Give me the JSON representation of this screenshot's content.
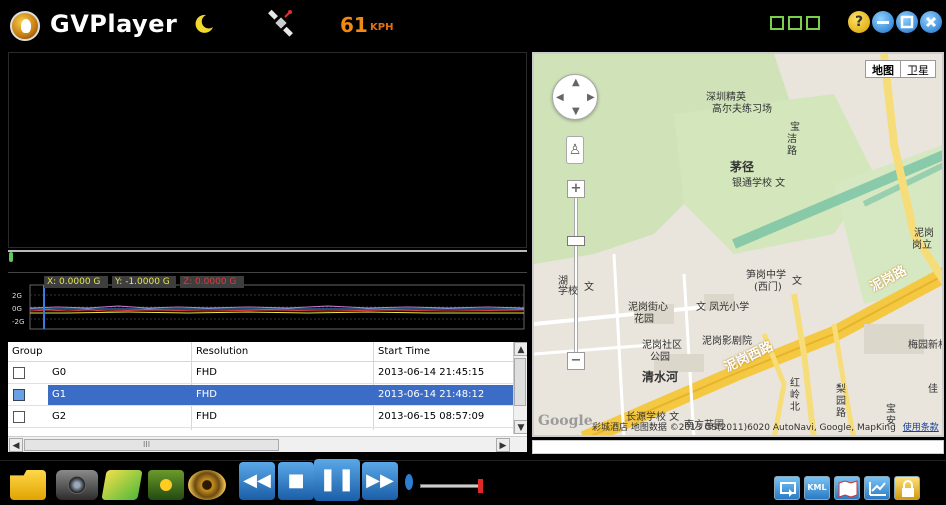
{
  "header": {
    "app_title": "GVPlayer",
    "speed_value": "61",
    "speed_unit": "KPH"
  },
  "gsensor": {
    "x_label": "X: 0.0000 G",
    "y_label": "Y: -1.0000 G",
    "z_label": "Z: 0.0000 G",
    "tick_top": "2G",
    "tick_mid": "0G",
    "tick_bottom": "-2G"
  },
  "file_table": {
    "columns": [
      "Group",
      "Resolution",
      "Start Time"
    ],
    "rows": [
      {
        "group": "G0",
        "resolution": "FHD",
        "start_time": "2013-06-14 21:45:15",
        "selected": false
      },
      {
        "group": "G1",
        "resolution": "FHD",
        "start_time": "2013-06-14 21:48:12",
        "selected": true
      },
      {
        "group": "G2",
        "resolution": "FHD",
        "start_time": "2013-06-15 08:57:09",
        "selected": false
      }
    ],
    "hscroll_grip": "III"
  },
  "map": {
    "type_map": "地图",
    "type_satellite": "卫星",
    "labels": [
      "深圳精英",
      "高尔夫练习场",
      "宝",
      "洁",
      "路",
      "茅径",
      "银通学校 文",
      "泥岗",
      "岗立",
      "湖",
      "学校",
      "文",
      "笋岗中学",
      "(西门)",
      "文",
      "泥岗街心",
      "花园",
      "文 凤光小学",
      "泥岗社区",
      "公园",
      "泥岗影剧院",
      "清水河",
      "梅园新村",
      "长源学校 文",
      "南方苗圃",
      "红",
      "岭",
      "北",
      "梨",
      "园",
      "路",
      "宝",
      "安",
      "佳"
    ],
    "road_1": "泥岗路",
    "road_2": "泥岗西路",
    "attribution": "彩城酒店 地图数据 ©2013 GS(2011)6020 AutoNavi, Google, MapKing",
    "terms_link": "使用条款",
    "google_logo": "Google",
    "zoom_in": "+",
    "zoom_out": "−",
    "zoom_out_small": "−"
  },
  "toolbar": {
    "prev_label": "◀◀",
    "stop_label": "■",
    "pause_label": "❚❚",
    "next_label": "▶▶",
    "kml_label": "KML",
    "help_label": "?"
  },
  "colors": {
    "accent_blue": "#3c6dc6",
    "speed_orange": "#f08a12",
    "gsensor_yellow": "#e8e84a",
    "gsensor_red": "#e03a3a",
    "road_yellow": "#f5c842",
    "green_strip": "#5fb08a"
  }
}
